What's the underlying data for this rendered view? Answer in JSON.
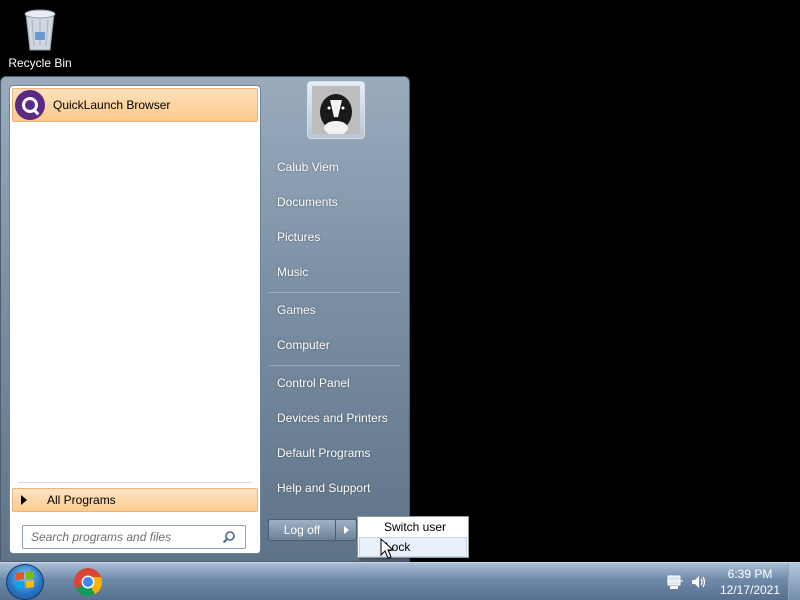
{
  "desktop": {
    "icons": [
      {
        "label": "Recycle Bin",
        "icon": "recycle-bin-icon"
      }
    ]
  },
  "start_menu": {
    "pinned": [
      {
        "label": "QuickLaunch Browser",
        "icon": "quicklaunch-browser-icon"
      }
    ],
    "all_programs_label": "All Programs",
    "search_placeholder": "Search programs and files",
    "user_picture": "user-picture-dog",
    "right_links": [
      {
        "label": "Calub Viem"
      },
      {
        "label": "Documents"
      },
      {
        "label": "Pictures"
      },
      {
        "label": "Music"
      },
      {
        "label": "Games"
      },
      {
        "label": "Computer"
      },
      {
        "label": "Control Panel"
      },
      {
        "label": "Devices and Printers"
      },
      {
        "label": "Default Programs"
      },
      {
        "label": "Help and Support"
      }
    ],
    "logoff_label": "Log off",
    "submenu": [
      {
        "label": "Switch user"
      },
      {
        "label": "Lock"
      }
    ]
  },
  "taskbar": {
    "pinned": [
      "start-orb-icon",
      "chrome-icon"
    ],
    "tray_icons": [
      "network-icon",
      "volume-icon"
    ],
    "time": "6:39 PM",
    "date": "12/17/2021"
  },
  "colors": {
    "start_menu_bg": "#7e92a7",
    "highlight": "#fcc98a",
    "taskbar": "#6f8aa8"
  }
}
